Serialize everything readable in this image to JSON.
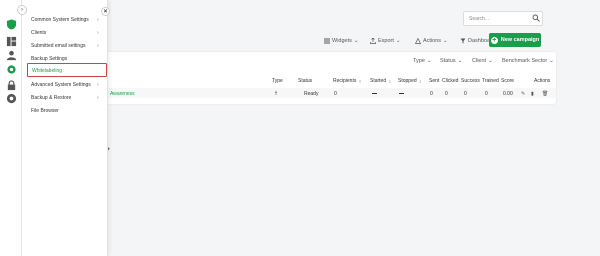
{
  "colors": {
    "brand": "#1a9e4b",
    "highlight_border": "#cc4444"
  },
  "search": {
    "placeholder": "Search..."
  },
  "toolbar": {
    "widgets": "Widgets",
    "export": "Export",
    "actions": "Actions",
    "dashboard": "Dashboard",
    "new_campaign": "New campaign"
  },
  "filters": {
    "type": "Type",
    "status": "Status",
    "client": "Client",
    "benchmark": "Benchmark Sector"
  },
  "table": {
    "headers": [
      "Type",
      "Status",
      "Recipients",
      "Started",
      "Stopped",
      "Sent",
      "Clicked",
      "Success",
      "Trained",
      "Score",
      "Actions"
    ],
    "rows": [
      {
        "name": "Awareness",
        "status": "Ready",
        "recipients": "0",
        "sent": "0",
        "clicked": "0",
        "success": "0",
        "trained": "0",
        "score": "0.00"
      }
    ]
  },
  "menu": {
    "items": [
      {
        "label": "Common System Settings",
        "has_children": true
      },
      {
        "label": "Clients",
        "has_children": true
      },
      {
        "label": "Submitted email settings",
        "has_children": true
      },
      {
        "label": "Backup Settings",
        "has_children": false
      },
      {
        "label": "Whitelabeling",
        "has_children": false,
        "active": true
      },
      {
        "label": "Advanced System Settings",
        "has_children": true
      },
      {
        "label": "Backup & Restore",
        "has_children": true
      },
      {
        "label": "File Browser",
        "has_children": false
      }
    ]
  },
  "rail_icons": [
    "shield-icon",
    "dashboard-icon",
    "user-icon",
    "gear-icon",
    "lock-icon",
    "help-icon"
  ]
}
